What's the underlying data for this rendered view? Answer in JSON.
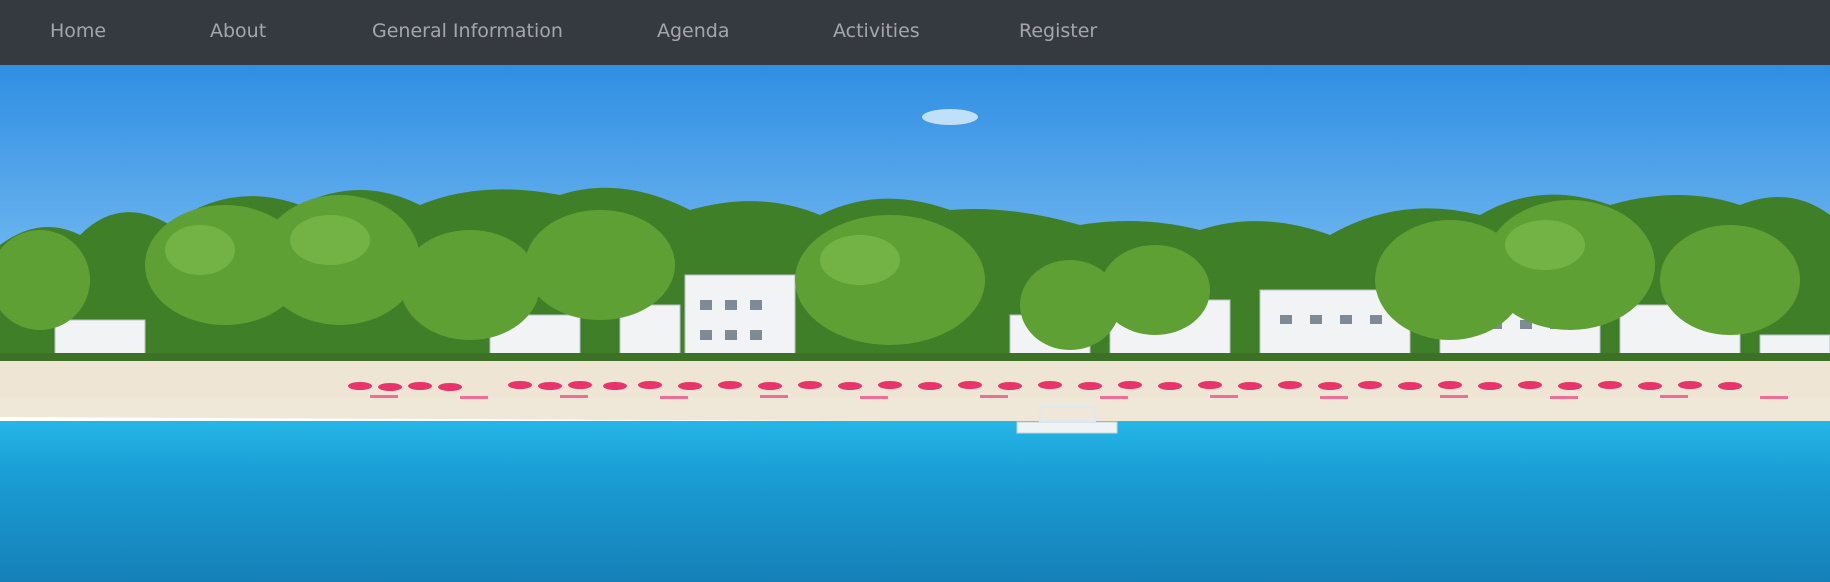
{
  "nav": {
    "items": [
      {
        "label": "Home"
      },
      {
        "label": "About"
      },
      {
        "label": "General Information"
      },
      {
        "label": "Agenda"
      },
      {
        "label": "Activities"
      },
      {
        "label": "Register"
      }
    ]
  },
  "hero": {
    "scene": "beach-resort-photo",
    "colors": {
      "navbar_bg": "#343a40",
      "nav_text": "#a7aaad",
      "sky": "#3f9be6",
      "sea": "#1a9fd6",
      "sand": "#efe7d8",
      "trees": "#4b8a2e",
      "umbrellas": "#e8336b"
    }
  }
}
